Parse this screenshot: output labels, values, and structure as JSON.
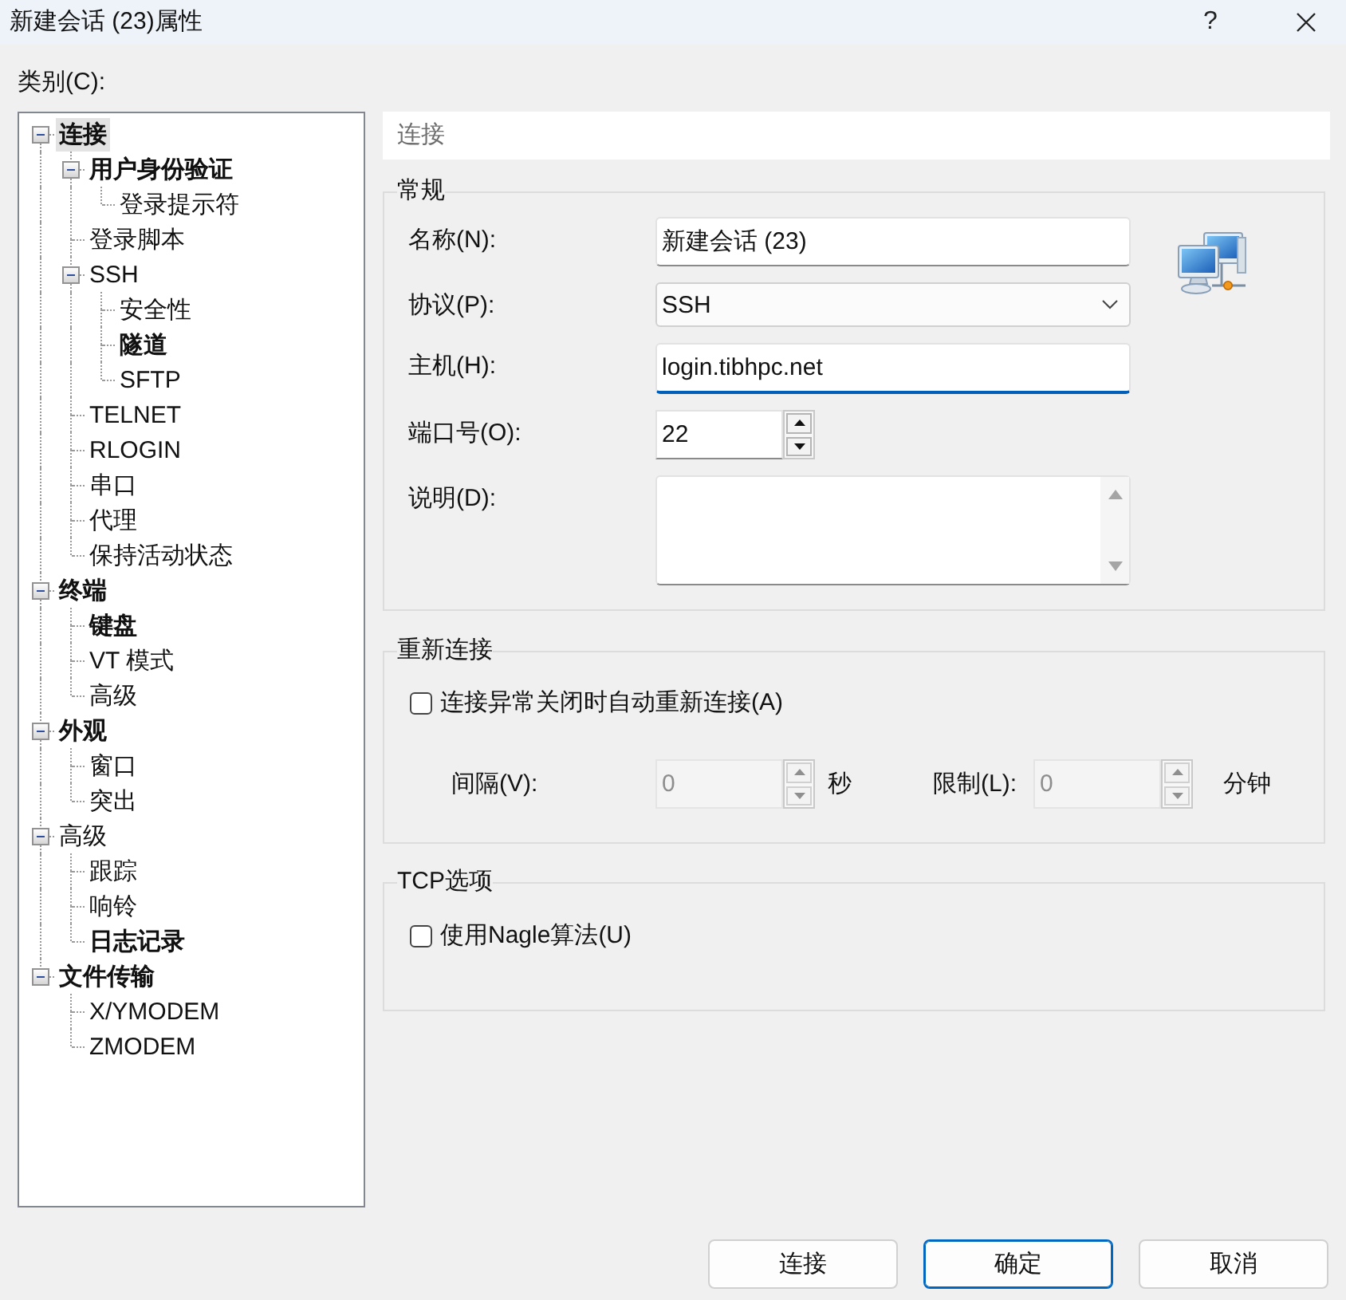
{
  "window": {
    "title": "新建会话 (23)属性",
    "help": "?"
  },
  "category_label": {
    "text": "类别(C):"
  },
  "tree": [
    {
      "label": "连接",
      "bold": true,
      "selected": true,
      "expanded": true,
      "children": [
        {
          "label": "用户身份验证",
          "bold": true,
          "selected": false,
          "expanded": true,
          "children": [
            {
              "label": "登录提示符",
              "bold": false,
              "selected": false
            }
          ]
        },
        {
          "label": "登录脚本",
          "bold": false,
          "selected": false
        },
        {
          "label": "SSH",
          "bold": false,
          "selected": false,
          "expanded": true,
          "children": [
            {
              "label": "安全性",
              "bold": false,
              "selected": false
            },
            {
              "label": "隧道",
              "bold": true,
              "selected": false
            },
            {
              "label": "SFTP",
              "bold": false,
              "selected": false
            }
          ]
        },
        {
          "label": "TELNET",
          "bold": false,
          "selected": false
        },
        {
          "label": "RLOGIN",
          "bold": false,
          "selected": false
        },
        {
          "label": "串口",
          "bold": false,
          "selected": false
        },
        {
          "label": "代理",
          "bold": false,
          "selected": false
        },
        {
          "label": "保持活动状态",
          "bold": false,
          "selected": false
        }
      ]
    },
    {
      "label": "终端",
      "bold": true,
      "selected": false,
      "expanded": true,
      "children": [
        {
          "label": "键盘",
          "bold": true,
          "selected": false
        },
        {
          "label": "VT 模式",
          "bold": false,
          "selected": false
        },
        {
          "label": "高级",
          "bold": false,
          "selected": false
        }
      ]
    },
    {
      "label": "外观",
      "bold": true,
      "selected": false,
      "expanded": true,
      "children": [
        {
          "label": "窗口",
          "bold": false,
          "selected": false
        },
        {
          "label": "突出",
          "bold": false,
          "selected": false
        }
      ]
    },
    {
      "label": "高级",
      "bold": false,
      "selected": false,
      "expanded": true,
      "children": [
        {
          "label": "跟踪",
          "bold": false,
          "selected": false
        },
        {
          "label": "响铃",
          "bold": false,
          "selected": false
        },
        {
          "label": "日志记录",
          "bold": true,
          "selected": false
        }
      ]
    },
    {
      "label": "文件传输",
      "bold": true,
      "selected": false,
      "expanded": true,
      "children": [
        {
          "label": "X/YMODEM",
          "bold": false,
          "selected": false
        },
        {
          "label": "ZMODEM",
          "bold": false,
          "selected": false
        }
      ]
    }
  ],
  "panel": {
    "header": "连接"
  },
  "general": {
    "title": "常规",
    "fields": [
      {
        "kind": "text",
        "label": "名称(N):",
        "value": "新建会话 (23)",
        "focused": false
      },
      {
        "kind": "select",
        "label": "协议(P):",
        "value": "SSH",
        "focused": false
      },
      {
        "kind": "text",
        "label": "主机(H):",
        "value": "login.tibhpc.net",
        "focused": true
      },
      {
        "kind": "spin",
        "label": "端口号(O):",
        "value": "22",
        "focused": false
      },
      {
        "kind": "memo",
        "label": "说明(D):",
        "focused": false
      }
    ]
  },
  "reconnect": {
    "title": "重新连接",
    "checkbox": {
      "label": "连接异常关闭时自动重新连接(A)",
      "checked": false
    },
    "interval": {
      "label": "间隔(V):",
      "value": "0",
      "unit": "秒",
      "disabled": true
    },
    "limit": {
      "label": "限制(L):",
      "value": "0",
      "unit": "分钟",
      "disabled": true
    }
  },
  "tcp": {
    "title": "TCP选项",
    "checkbox": {
      "label": "使用Nagle算法(U)",
      "checked": false
    }
  },
  "buttons": [
    {
      "label": "连接",
      "default": false
    },
    {
      "label": "确定",
      "default": true
    },
    {
      "label": "取消",
      "default": false
    }
  ]
}
